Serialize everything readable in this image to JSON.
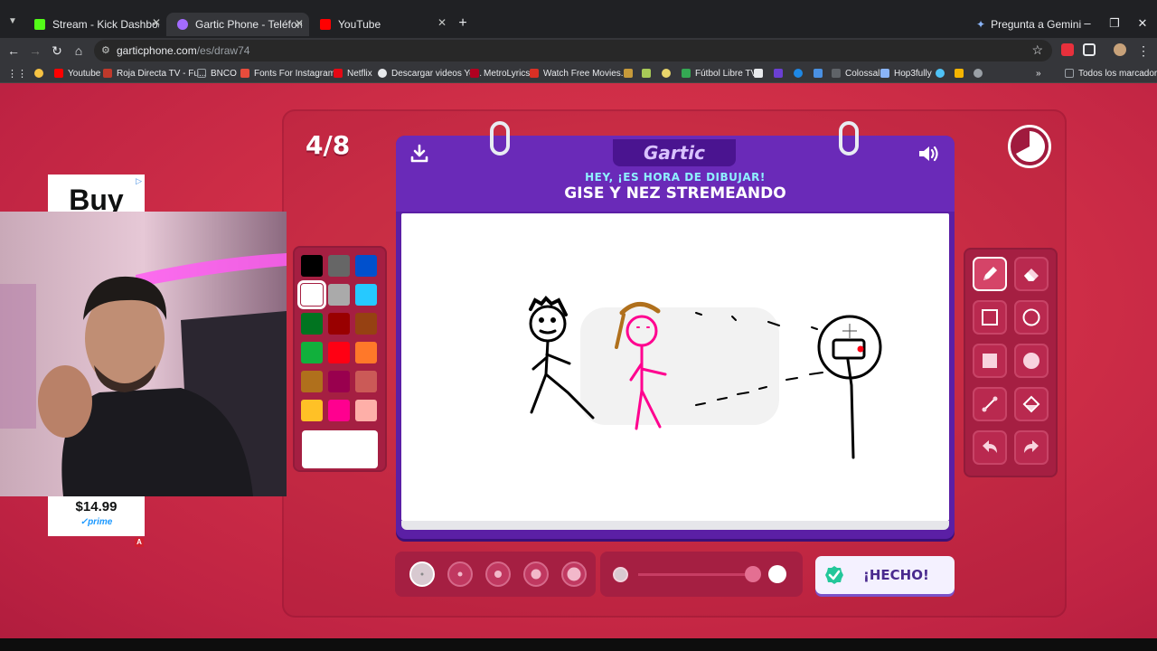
{
  "browser": {
    "tabs": [
      {
        "title": "Stream - Kick Dashboard",
        "favicon_color": "#53fc18",
        "active": false
      },
      {
        "title": "Gartic Phone - Teléfono Desconocido",
        "favicon_color": "#a36bff",
        "active": true
      },
      {
        "title": "YouTube",
        "favicon_color": "#ff0000",
        "active": false
      }
    ],
    "gemini_label": "Pregunta a Gemini",
    "url_host": "garticphone.com",
    "url_path": "/es/draw74",
    "bookmarks": [
      {
        "label": "",
        "color": "#f6c343"
      },
      {
        "label": "Youtube",
        "color": "#ff0000"
      },
      {
        "label": "Roja Directa TV - Fu...",
        "color": "#c0392b"
      },
      {
        "label": "BNCO",
        "color": "#9aa0a6"
      },
      {
        "label": "Fonts For Instagram...",
        "color": "#e74c3c"
      },
      {
        "label": "Netflix",
        "color": "#e50914"
      },
      {
        "label": "Descargar videos Yo...",
        "color": "#e8eaed"
      },
      {
        "label": "MetroLyrics",
        "color": "#b00020"
      },
      {
        "label": "Watch Free Movies...",
        "color": "#d93025"
      },
      {
        "label": "Fútbol Libre TV",
        "color": "#34a853"
      },
      {
        "label": "Colossal",
        "color": "#5f6368"
      },
      {
        "label": "Hop3fully",
        "color": "#8ab4f8"
      },
      {
        "label": "Todos los marcadores",
        "color": "#9aa0a6"
      }
    ]
  },
  "game": {
    "round": "4/8",
    "logo": "Gartic",
    "subtitle": "HEY, ¡ES HORA DE DIBUJAR!",
    "prompt": "GISE Y NEZ STREMEANDO",
    "done_label": "¡HECHO!",
    "palette": [
      "#000000",
      "#666666",
      "#0050cd",
      "#ffffff",
      "#aaaaaa",
      "#26c9ff",
      "#017420",
      "#990000",
      "#964112",
      "#11b03c",
      "#ff0013",
      "#ff7829",
      "#b0701c",
      "#99004e",
      "#cb5a57",
      "#ffc126",
      "#ff008f",
      "#feafa8"
    ],
    "selected_color": "#ffffff",
    "tools": [
      "pencil-icon",
      "eraser-icon",
      "rect-outline-icon",
      "circle-outline-icon",
      "rect-fill-icon",
      "circle-fill-icon",
      "line-icon",
      "fill-bucket-icon",
      "undo-icon",
      "redo-icon"
    ],
    "active_tool": "pencil-icon",
    "brush_sizes": 5,
    "active_brush": 1,
    "opacity_level": 1.0
  },
  "ad": {
    "headline": "Buy",
    "price": "$14.99",
    "prime": "✓prime"
  }
}
